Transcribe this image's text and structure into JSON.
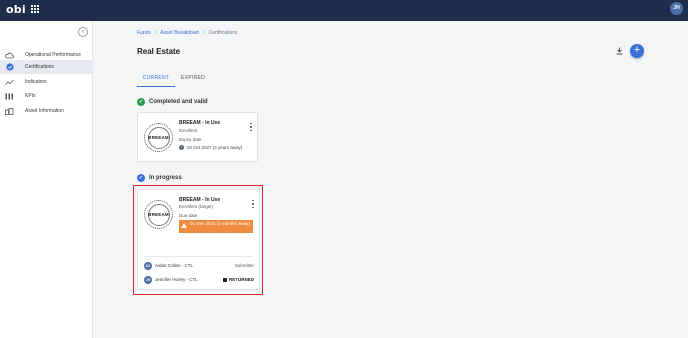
{
  "topbar": {
    "logo": "obi",
    "user_initials": "JH"
  },
  "sidebar": {
    "items": [
      {
        "label": "Operational Performance",
        "icon": "cloud-icon"
      },
      {
        "label": "Certifications",
        "icon": "check-circle-icon",
        "active": true
      },
      {
        "label": "Indicators",
        "icon": "trend-line-icon"
      },
      {
        "label": "KPIs",
        "icon": "bars-icon"
      },
      {
        "label": "Asset Information",
        "icon": "building-icon"
      }
    ]
  },
  "breadcrumb": {
    "items": [
      "Funds",
      "Asset Breakdown",
      "Certifications"
    ]
  },
  "page": {
    "title": "Real Estate"
  },
  "tabs": {
    "current": "CURRENT",
    "expired": "EXPIRED"
  },
  "sections": {
    "completed": {
      "title": "Completed and valid",
      "card": {
        "seal_text": "BREEAM",
        "title": "BREEAM - In Use",
        "rating": "Excellent",
        "date_label": "Expiry date",
        "date_value": "02 Oct 2027 (3 years away)"
      }
    },
    "in_progress": {
      "title": "In progress",
      "card": {
        "seal_text": "BREEAM",
        "title": "BREEAM - In Use",
        "rating": "Excellent (target)",
        "date_label": "Due date",
        "due_value": "01 Dec 2024 (3 months away)",
        "people": [
          {
            "initials": "AC",
            "name": "Aidan Collen - CTL",
            "role": "Submitter"
          },
          {
            "initials": "JH",
            "name": "Jennifer Hurley - CTL",
            "status": "RETURNED"
          }
        ]
      }
    }
  },
  "colors": {
    "accent": "#3a6fd8",
    "topbar": "#1f2d4d",
    "success": "#2e9c58",
    "warning": "#f08b3e",
    "highlight": "#d62828"
  }
}
